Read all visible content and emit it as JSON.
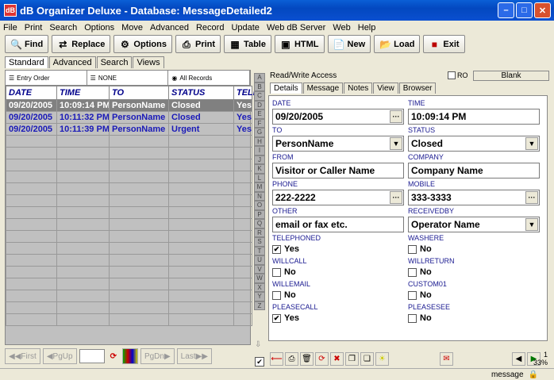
{
  "window": {
    "title": "dB Organizer Deluxe - Database: MessageDetailed2"
  },
  "menu": [
    "File",
    "Print",
    "Search",
    "Options",
    "Move",
    "Advanced",
    "Record",
    "Update",
    "Web dB Server",
    "Web",
    "Help"
  ],
  "toolbar": [
    {
      "label": "Find",
      "icon": "magnifier-icon"
    },
    {
      "label": "Replace",
      "icon": "replace-icon"
    },
    {
      "label": "Options",
      "icon": "options-icon"
    },
    {
      "label": "Print",
      "icon": "printer-icon"
    },
    {
      "label": "Table",
      "icon": "table-icon"
    },
    {
      "label": "HTML",
      "icon": "html-icon"
    },
    {
      "label": "New",
      "icon": "new-doc-icon"
    },
    {
      "label": "Load",
      "icon": "load-icon"
    },
    {
      "label": "Exit",
      "icon": "exit-icon"
    }
  ],
  "left_tabs": [
    "Standard",
    "Advanced",
    "Search",
    "Views"
  ],
  "sort_bar": [
    "Entry Order",
    "NONE",
    "All Records"
  ],
  "grid": {
    "columns": [
      "DATE",
      "TIME",
      "TO",
      "STATUS",
      "TELE"
    ],
    "rows": [
      [
        "09/20/2005",
        "10:09:14 PM",
        "PersonName",
        "Closed",
        "Yes"
      ],
      [
        "09/20/2005",
        "10:11:32 PM",
        "PersonName",
        "Closed",
        "Yes"
      ],
      [
        "09/20/2005",
        "10:11:39 PM",
        "PersonName",
        "Urgent",
        "Yes"
      ]
    ]
  },
  "nav": {
    "first": "First",
    "pgup": "PgUp",
    "pgdn": "PgDn",
    "last": "Last"
  },
  "alphabet": [
    "A",
    "B",
    "C",
    "D",
    "E",
    "F",
    "G",
    "H",
    "I",
    "J",
    "K",
    "L",
    "M",
    "N",
    "O",
    "P",
    "Q",
    "R",
    "S",
    "T",
    "U",
    "V",
    "W",
    "X",
    "Y",
    "Z"
  ],
  "access": {
    "text": "Read/Write Access",
    "ro_label": "RO",
    "blank_label": "Blank"
  },
  "right_tabs": [
    "Details",
    "Message",
    "Notes",
    "View",
    "Browser"
  ],
  "form": {
    "date": {
      "label": "DATE",
      "value": "09/20/2005"
    },
    "time": {
      "label": "TIME",
      "value": "10:09:14 PM"
    },
    "to": {
      "label": "TO",
      "value": "PersonName"
    },
    "status": {
      "label": "STATUS",
      "value": "Closed"
    },
    "from": {
      "label": "FROM",
      "value": "Visitor or Caller Name"
    },
    "company": {
      "label": "COMPANY",
      "value": "Company Name"
    },
    "phone": {
      "label": "PHONE",
      "value": "222-2222"
    },
    "mobile": {
      "label": "MOBILE",
      "value": "333-3333"
    },
    "other": {
      "label": "OTHER",
      "value": "email or fax etc."
    },
    "receivedby": {
      "label": "RECEIVEDBY",
      "value": "Operator Name"
    },
    "telephoned": {
      "label": "TELEPHONED",
      "value": "Yes",
      "checked": true
    },
    "washere": {
      "label": "WASHERE",
      "value": "No",
      "checked": false
    },
    "willcall": {
      "label": "WILLCALL",
      "value": "No",
      "checked": false
    },
    "willreturn": {
      "label": "WILLRETURN",
      "value": "No",
      "checked": false
    },
    "willemail": {
      "label": "WILLEMAIL",
      "value": "No",
      "checked": false
    },
    "custom01": {
      "label": "CUSTOM01",
      "value": "No",
      "checked": false
    },
    "pleasecall": {
      "label": "PLEASECALL",
      "value": "Yes",
      "checked": true
    },
    "pleasesee": {
      "label": "PLEASESEE",
      "value": "No",
      "checked": false
    }
  },
  "record_info": {
    "count": "1",
    "percent": "33%"
  },
  "status_bar": {
    "text": "message"
  }
}
